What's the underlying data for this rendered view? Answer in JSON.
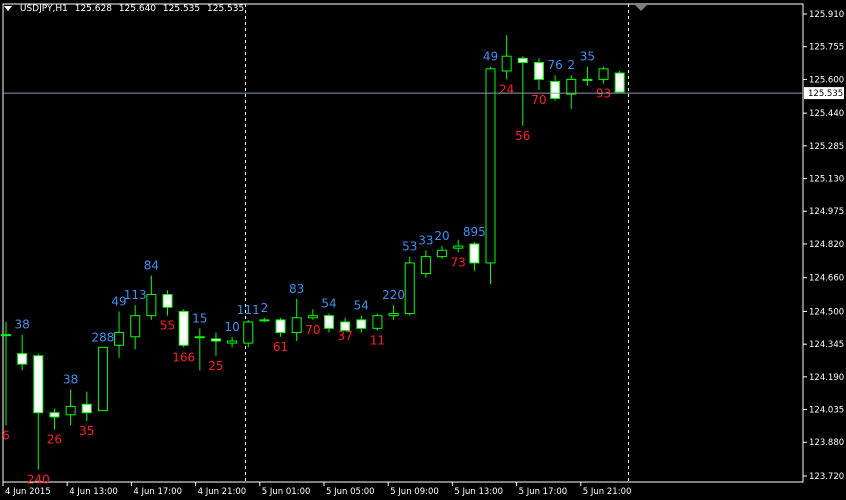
{
  "header": {
    "symbol": "USDJPY,H1",
    "open": "125.628",
    "high": "125.640",
    "low": "125.535",
    "close": "125.535"
  },
  "chart_data": {
    "type": "candlestick",
    "symbol": "USDJPY",
    "timeframe": "H1",
    "ylim": [
      123.72,
      125.91
    ],
    "y_ticks": [
      "125.910",
      "125.755",
      "125.600",
      "125.440",
      "125.285",
      "125.130",
      "124.975",
      "124.820",
      "124.660",
      "124.500",
      "124.345",
      "124.190",
      "124.035",
      "123.880",
      "123.720"
    ],
    "x_ticks": [
      "4 Jun 2015",
      "4 Jun 13:00",
      "4 Jun 17:00",
      "4 Jun 21:00",
      "5 Jun 01:00",
      "5 Jun 05:00",
      "5 Jun 09:00",
      "5 Jun 13:00",
      "5 Jun 17:00",
      "5 Jun 21:00"
    ],
    "current_price": "125.535",
    "colors": {
      "background": "#000000",
      "bull": "#00ff00",
      "bear_body": "#ffffff",
      "grid": "#ffffff",
      "axis_text": "#ffffff",
      "label_blue": "#3f8ff0",
      "label_red": "#ff2020",
      "price_line": "#8a9ab0"
    },
    "candles": [
      {
        "o": 124.39,
        "h": 124.45,
        "l": 123.96,
        "c": 124.39
      },
      {
        "o": 124.3,
        "h": 124.39,
        "l": 124.22,
        "c": 124.25
      },
      {
        "o": 124.29,
        "h": 124.3,
        "l": 123.75,
        "c": 124.02
      },
      {
        "o": 124.02,
        "h": 124.04,
        "l": 123.94,
        "c": 124.0
      },
      {
        "o": 124.01,
        "h": 124.13,
        "l": 123.96,
        "c": 124.05
      },
      {
        "o": 124.06,
        "h": 124.12,
        "l": 123.98,
        "c": 124.02
      },
      {
        "o": 124.03,
        "h": 124.33,
        "l": 124.03,
        "c": 124.33
      },
      {
        "o": 124.34,
        "h": 124.5,
        "l": 124.28,
        "c": 124.4
      },
      {
        "o": 124.38,
        "h": 124.53,
        "l": 124.32,
        "c": 124.48
      },
      {
        "o": 124.48,
        "h": 124.67,
        "l": 124.46,
        "c": 124.58
      },
      {
        "o": 124.58,
        "h": 124.6,
        "l": 124.48,
        "c": 124.52
      },
      {
        "o": 124.5,
        "h": 124.51,
        "l": 124.33,
        "c": 124.34
      },
      {
        "o": 124.38,
        "h": 124.42,
        "l": 124.22,
        "c": 124.38
      },
      {
        "o": 124.37,
        "h": 124.4,
        "l": 124.29,
        "c": 124.36
      },
      {
        "o": 124.35,
        "h": 124.38,
        "l": 124.33,
        "c": 124.36
      },
      {
        "o": 124.35,
        "h": 124.46,
        "l": 124.33,
        "c": 124.45
      },
      {
        "o": 124.46,
        "h": 124.47,
        "l": 124.45,
        "c": 124.46
      },
      {
        "o": 124.46,
        "h": 124.47,
        "l": 124.38,
        "c": 124.4
      },
      {
        "o": 124.4,
        "h": 124.56,
        "l": 124.36,
        "c": 124.47
      },
      {
        "o": 124.47,
        "h": 124.51,
        "l": 124.46,
        "c": 124.48
      },
      {
        "o": 124.48,
        "h": 124.49,
        "l": 124.4,
        "c": 124.42
      },
      {
        "o": 124.45,
        "h": 124.47,
        "l": 124.43,
        "c": 124.41
      },
      {
        "o": 124.46,
        "h": 124.48,
        "l": 124.4,
        "c": 124.42
      },
      {
        "o": 124.42,
        "h": 124.49,
        "l": 124.41,
        "c": 124.48
      },
      {
        "o": 124.48,
        "h": 124.53,
        "l": 124.46,
        "c": 124.49
      },
      {
        "o": 124.49,
        "h": 124.76,
        "l": 124.48,
        "c": 124.73
      },
      {
        "o": 124.68,
        "h": 124.79,
        "l": 124.66,
        "c": 124.76
      },
      {
        "o": 124.76,
        "h": 124.81,
        "l": 124.75,
        "c": 124.79
      },
      {
        "o": 124.8,
        "h": 124.84,
        "l": 124.78,
        "c": 124.81
      },
      {
        "o": 124.82,
        "h": 124.83,
        "l": 124.69,
        "c": 124.73
      },
      {
        "o": 124.73,
        "h": 125.66,
        "l": 124.63,
        "c": 125.65
      },
      {
        "o": 125.64,
        "h": 125.81,
        "l": 125.6,
        "c": 125.71
      },
      {
        "o": 125.7,
        "h": 125.71,
        "l": 125.38,
        "c": 125.68
      },
      {
        "o": 125.68,
        "h": 125.7,
        "l": 125.55,
        "c": 125.6
      },
      {
        "o": 125.59,
        "h": 125.62,
        "l": 125.5,
        "c": 125.51
      },
      {
        "o": 125.53,
        "h": 125.62,
        "l": 125.46,
        "c": 125.6
      },
      {
        "o": 125.6,
        "h": 125.66,
        "l": 125.57,
        "c": 125.6
      },
      {
        "o": 125.6,
        "h": 125.66,
        "l": 125.58,
        "c": 125.65
      },
      {
        "o": 125.63,
        "h": 125.64,
        "l": 125.54,
        "c": 125.54
      }
    ],
    "annotations": [
      {
        "i": 0,
        "text": "6",
        "color": "red",
        "pos": "below"
      },
      {
        "i": 1,
        "text": "38",
        "color": "blue",
        "pos": "above"
      },
      {
        "i": 2,
        "text": "240",
        "color": "red",
        "pos": "below"
      },
      {
        "i": 3,
        "text": "26",
        "color": "red",
        "pos": "below"
      },
      {
        "i": 4,
        "text": "38",
        "color": "blue",
        "pos": "above"
      },
      {
        "i": 5,
        "text": "35",
        "color": "red",
        "pos": "below"
      },
      {
        "i": 6,
        "text": "288",
        "color": "blue",
        "pos": "above"
      },
      {
        "i": 7,
        "text": "49",
        "color": "blue",
        "pos": "above"
      },
      {
        "i": 8,
        "text": "113",
        "color": "blue",
        "pos": "above"
      },
      {
        "i": 9,
        "text": "84",
        "color": "blue",
        "pos": "above"
      },
      {
        "i": 10,
        "text": "55",
        "color": "red",
        "pos": "below"
      },
      {
        "i": 11,
        "text": "166",
        "color": "red",
        "pos": "below"
      },
      {
        "i": 12,
        "text": "15",
        "color": "blue",
        "pos": "above"
      },
      {
        "i": 13,
        "text": "25",
        "color": "red",
        "pos": "below"
      },
      {
        "i": 14,
        "text": "10",
        "color": "blue",
        "pos": "above"
      },
      {
        "i": 15,
        "text": "111",
        "color": "blue",
        "pos": "above"
      },
      {
        "i": 16,
        "text": "2",
        "color": "blue",
        "pos": "above"
      },
      {
        "i": 17,
        "text": "61",
        "color": "red",
        "pos": "below"
      },
      {
        "i": 18,
        "text": "83",
        "color": "blue",
        "pos": "above"
      },
      {
        "i": 19,
        "text": "70",
        "color": "red",
        "pos": "below"
      },
      {
        "i": 20,
        "text": "54",
        "color": "blue",
        "pos": "above"
      },
      {
        "i": 21,
        "text": "37",
        "color": "red",
        "pos": "below"
      },
      {
        "i": 22,
        "text": "54",
        "color": "blue",
        "pos": "above"
      },
      {
        "i": 23,
        "text": "11",
        "color": "red",
        "pos": "below"
      },
      {
        "i": 24,
        "text": "220",
        "color": "blue",
        "pos": "above"
      },
      {
        "i": 25,
        "text": "53",
        "color": "blue",
        "pos": "above"
      },
      {
        "i": 26,
        "text": "33",
        "color": "blue",
        "pos": "above"
      },
      {
        "i": 27,
        "text": "20",
        "color": "blue",
        "pos": "above"
      },
      {
        "i": 28,
        "text": "73",
        "color": "red",
        "pos": "below"
      },
      {
        "i": 29,
        "text": "895",
        "color": "blue",
        "pos": "above"
      },
      {
        "i": 30,
        "text": "49",
        "color": "blue",
        "pos": "above"
      },
      {
        "i": 31,
        "text": "24",
        "color": "red",
        "pos": "below"
      },
      {
        "i": 32,
        "text": "56",
        "color": "red",
        "pos": "below"
      },
      {
        "i": 33,
        "text": "70",
        "color": "red",
        "pos": "below"
      },
      {
        "i": 34,
        "text": "76",
        "color": "blue",
        "pos": "above"
      },
      {
        "i": 35,
        "text": "2",
        "color": "blue",
        "pos": "above"
      },
      {
        "i": 36,
        "text": "35",
        "color": "blue",
        "pos": "above"
      },
      {
        "i": 37,
        "text": "93",
        "color": "red",
        "pos": "below"
      }
    ]
  }
}
